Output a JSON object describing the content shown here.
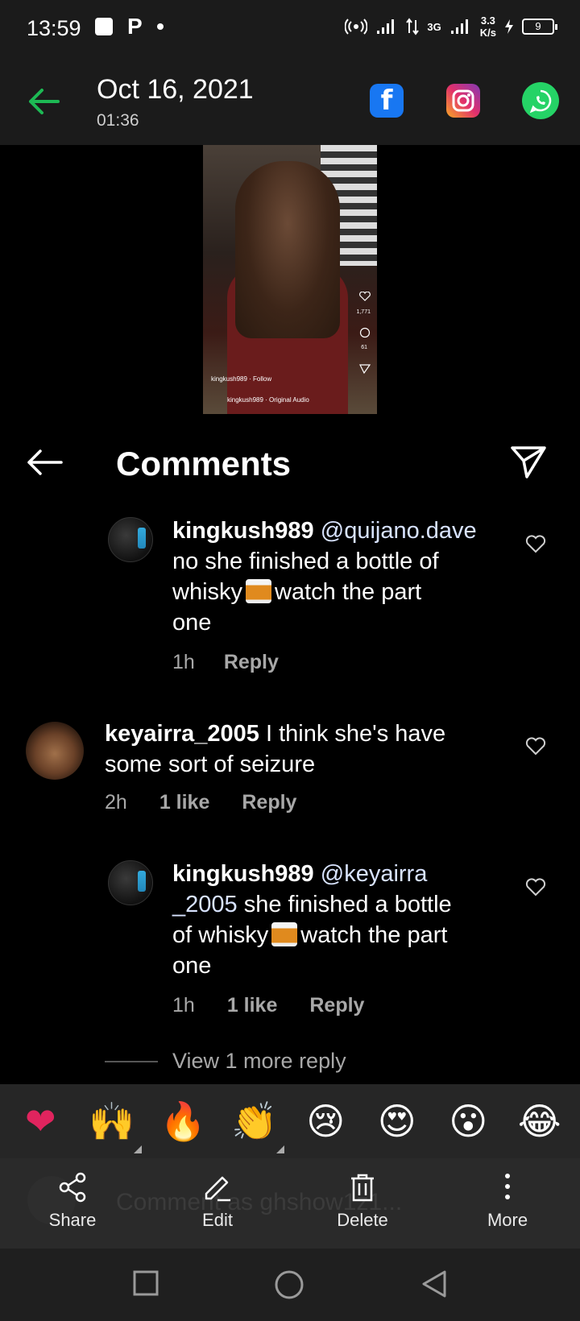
{
  "status_bar": {
    "time": "13:59",
    "network": "3G",
    "speed_value": "3.3",
    "speed_unit": "K/s",
    "battery": "9"
  },
  "header": {
    "date": "Oct 16, 2021",
    "time": "01:36",
    "share_targets": [
      "facebook-icon",
      "instagram-icon",
      "whatsapp-icon"
    ]
  },
  "video": {
    "likes": "1,771",
    "comments": "61",
    "account": "kingkush989 · Follow",
    "audio": "kingkush989 · Original Audio"
  },
  "comments_header": {
    "title": "Comments"
  },
  "comments": [
    {
      "user": "kingkush989",
      "mention": "@quijano.dave",
      "line1": "no she finished a bottle of",
      "line2a": "whisky",
      "line2b": "watch the part",
      "line3": "one",
      "time": "1h",
      "reply": "Reply"
    },
    {
      "user": "keyairra_2005",
      "line1": "I think she's have",
      "line2": "some sort of seizure",
      "time": "2h",
      "likes": "1 like",
      "reply": "Reply"
    },
    {
      "user": "kingkush989",
      "mention1": "@keyairra",
      "mention2": "_2005",
      "line2b": "she finished a bottle",
      "line3a": "of whisky",
      "line3b": "watch the part",
      "line4": "one",
      "time": "1h",
      "likes": "1 like",
      "reply": "Reply"
    }
  ],
  "view_more": "View 1 more reply",
  "emoji_bar": [
    "❤",
    "🙌",
    "🔥",
    "👏",
    "😢",
    "😍",
    "😮",
    "😂"
  ],
  "comment_input_placeholder": "Comment as ghshow1z1...",
  "actions": {
    "share": "Share",
    "edit": "Edit",
    "delete": "Delete",
    "more": "More"
  },
  "colors": {
    "accent_green": "#1db954",
    "background": "#000000",
    "bar": "#2a2a2a"
  }
}
